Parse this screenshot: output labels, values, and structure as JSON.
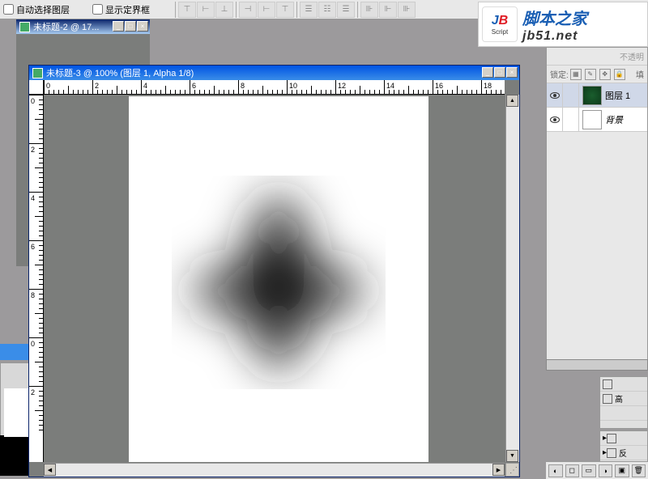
{
  "toolbar": {
    "auto_select_label": "自动选择图层",
    "show_bounds_label": "显示定界框"
  },
  "watermark": {
    "logo_j": "J",
    "logo_b": "B",
    "logo_sub": "Script",
    "title": "脚本之家",
    "url": "jb51.net"
  },
  "doc1": {
    "title": "未标题-2 @ 17..."
  },
  "doc2": {
    "title": "未标题-3 @ 100% (图层 1, Alpha 1/8)",
    "ruler_h": [
      "0",
      "2",
      "4",
      "6",
      "8",
      "10",
      "12",
      "14",
      "16",
      "18"
    ],
    "ruler_v": [
      "0",
      "2",
      "4",
      "6",
      "8",
      "0",
      "2"
    ]
  },
  "layers": {
    "opacity_label": "不透明",
    "lock_label": "锁定:",
    "fill_label": "填",
    "layer1_name": "图层 1",
    "bg_name": "背景"
  },
  "right_panels": {
    "label1": "高",
    "label2": "反"
  }
}
